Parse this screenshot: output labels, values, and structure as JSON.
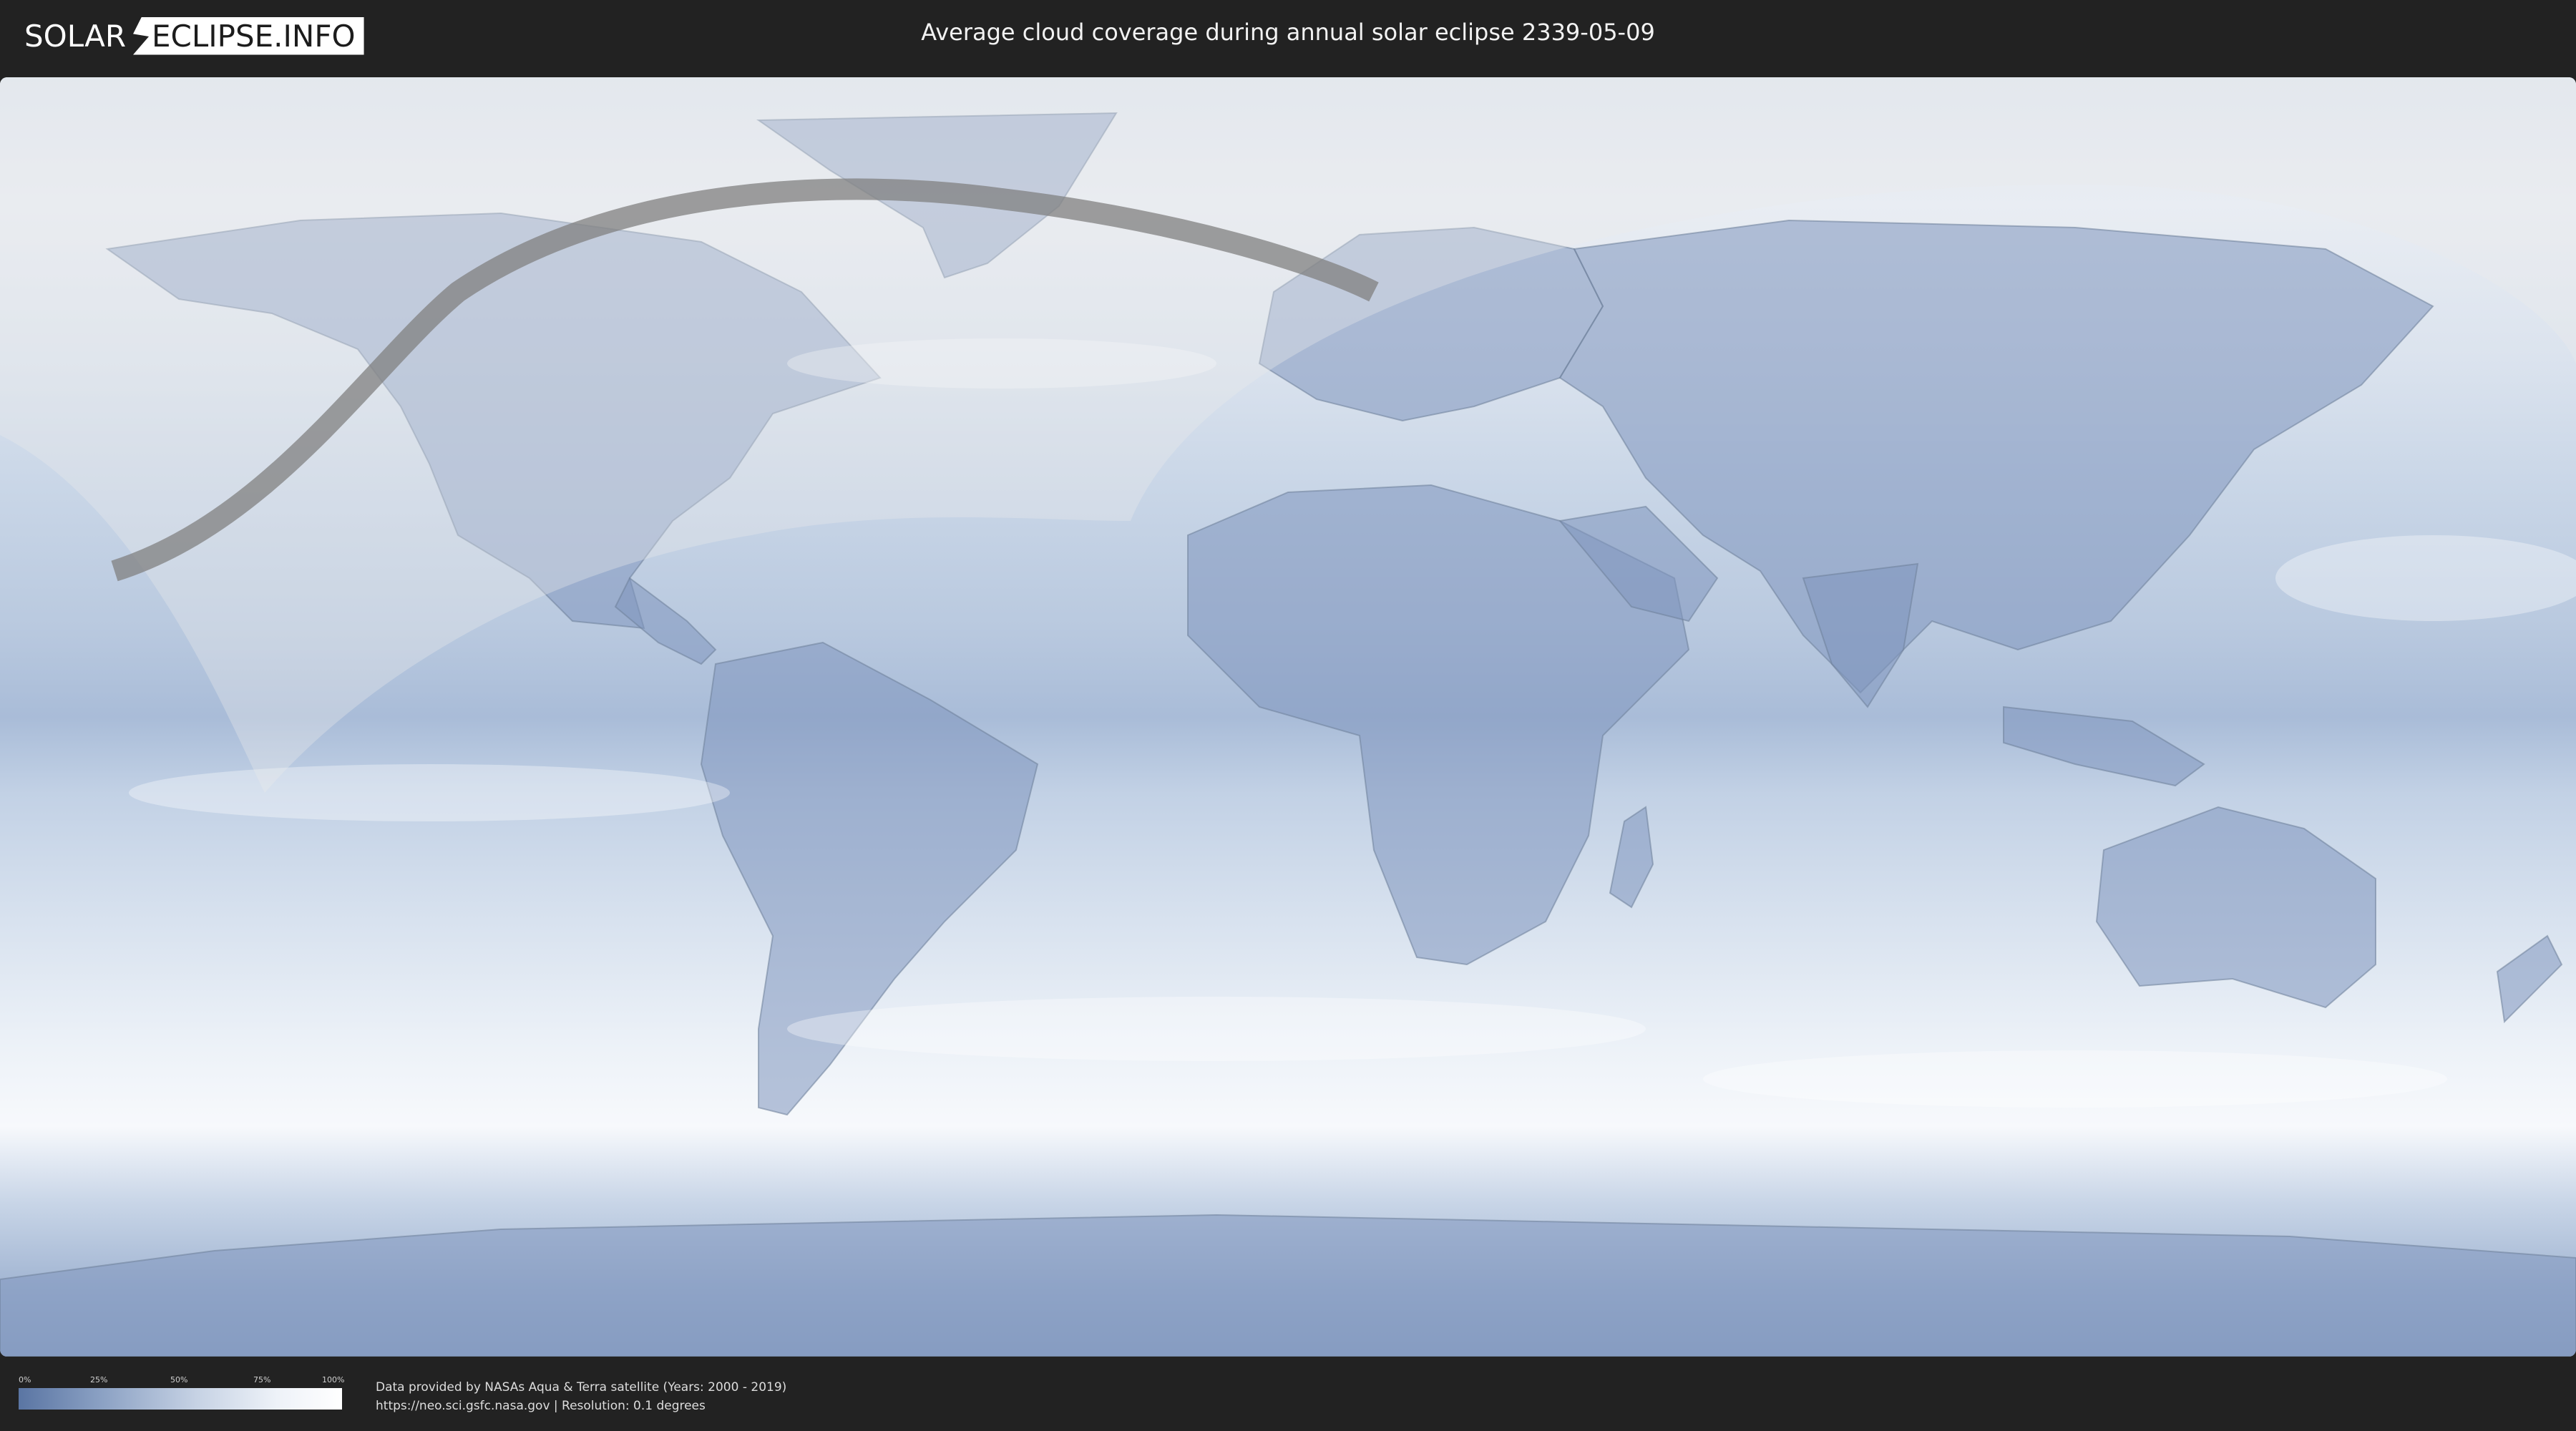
{
  "header": {
    "logo_left": "SOLAR",
    "logo_right": "ECLIPSE.INFO",
    "title": "Average cloud coverage during annual solar eclipse 2339-05-09"
  },
  "map": {
    "colors": {
      "cloud_low": "#5a75a3",
      "cloud_high": "#ffffff",
      "eclipse_path": "#808080",
      "visibility_zone": "#ececec"
    }
  },
  "legend": {
    "ticks": [
      "0%",
      "25%",
      "50%",
      "75%",
      "100%"
    ]
  },
  "credits": {
    "line1": "Data provided by NASAs Aqua & Terra satellite (Years: 2000 - 2019)",
    "line2": "https://neo.sci.gsfc.nasa.gov | Resolution: 0.1 degrees"
  }
}
